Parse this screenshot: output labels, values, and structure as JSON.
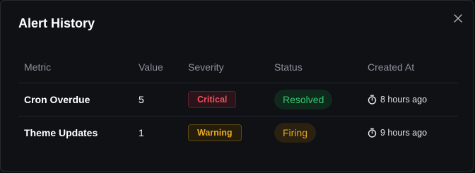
{
  "modal": {
    "title": "Alert History",
    "close_icon": "close-icon"
  },
  "table": {
    "headers": {
      "metric": "Metric",
      "value": "Value",
      "severity": "Severity",
      "status": "Status",
      "created_at": "Created At"
    },
    "rows": [
      {
        "metric": "Cron Overdue",
        "value": "5",
        "severity": "Critical",
        "status": "Resolved",
        "created_at": "8 hours ago",
        "created_icon": "stopwatch-icon"
      },
      {
        "metric": "Theme Updates",
        "value": "1",
        "severity": "Warning",
        "status": "Firing",
        "created_at": "9 hours ago",
        "created_icon": "stopwatch-icon"
      }
    ]
  },
  "colors": {
    "background": "#0f1115",
    "critical": "#f0505f",
    "warning": "#e9a825",
    "resolved": "#38c46f"
  }
}
